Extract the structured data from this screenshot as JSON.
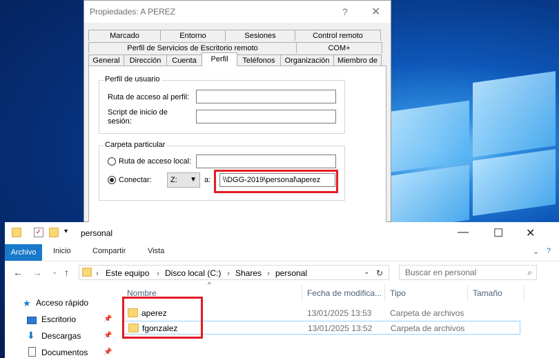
{
  "dialog": {
    "title": "Propiedades: A PEREZ",
    "help_glyph": "?",
    "close_glyph": "✕",
    "tabs_row1": [
      "Marcado",
      "Entorno",
      "Sesiones",
      "Control remoto"
    ],
    "tabs_row2": [
      "Perfil de Servicios de Escritorio remoto",
      "COM+"
    ],
    "tabs_row3": [
      "General",
      "Dirección",
      "Cuenta",
      "Perfil",
      "Teléfonos",
      "Organización",
      "Miembro de"
    ],
    "active_tab": "Perfil",
    "user_profile": {
      "legend": "Perfil de usuario",
      "profile_path_label": "Ruta de acceso al perfil:",
      "profile_path_value": "",
      "logon_script_label": "Script de inicio de sesión:",
      "logon_script_value": ""
    },
    "home_folder": {
      "legend": "Carpeta particular",
      "local_path_label": "Ruta de acceso local:",
      "local_path_value": "",
      "connect_label": "Conectar:",
      "drive": "Z:",
      "to_label": "a:",
      "connect_path": "\\\\DGG-2019\\personal\\aperez",
      "selected": "connect"
    }
  },
  "explorer": {
    "title": "personal",
    "ribbon_tabs": [
      "Archivo",
      "Inicio",
      "Compartir",
      "Vista"
    ],
    "address": [
      "Este equipo",
      "Disco local (C:)",
      "Shares",
      "personal"
    ],
    "search_placeholder": "Buscar en personal",
    "nav_items": [
      {
        "label": "Acceso rápido",
        "icon": "star-icon"
      },
      {
        "label": "Escritorio",
        "icon": "desktop-icon",
        "pinned": true
      },
      {
        "label": "Descargas",
        "icon": "download-icon",
        "pinned": true
      },
      {
        "label": "Documentos",
        "icon": "document-icon",
        "pinned": true
      }
    ],
    "columns": [
      "Nombre",
      "Fecha de modifica...",
      "Tipo",
      "Tamaño"
    ],
    "files": [
      {
        "name": "aperez",
        "date": "13/01/2025 13:53",
        "type": "Carpeta de archivos",
        "size": ""
      },
      {
        "name": "fgonzalez",
        "date": "13/01/2025 13:52",
        "type": "Carpeta de archivos",
        "size": ""
      }
    ]
  },
  "colors": {
    "accent": "#1979ca",
    "highlight": "#e31b23",
    "selection_border": "#99d1ff"
  }
}
